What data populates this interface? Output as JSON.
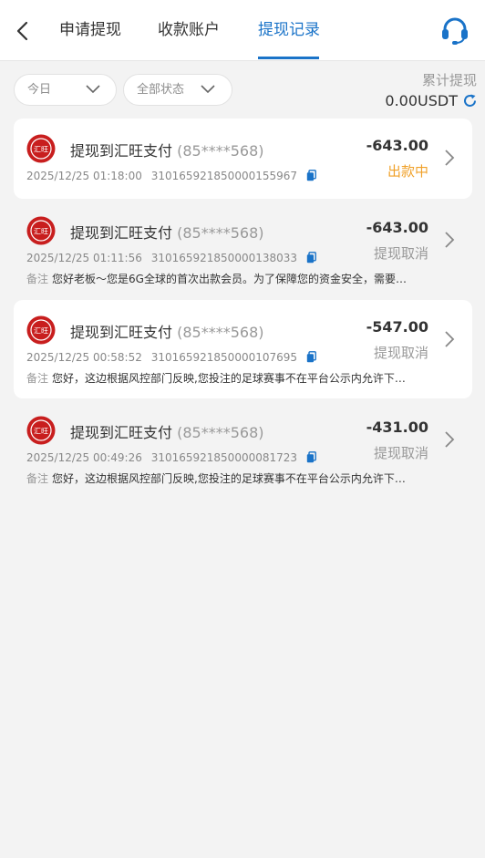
{
  "header": {
    "tabs": [
      {
        "label": "申请提现",
        "active": false
      },
      {
        "label": "收款账户",
        "active": false
      },
      {
        "label": "提现记录",
        "active": true
      }
    ],
    "accent_color": "#1a73c8"
  },
  "filters": {
    "date": "今日",
    "status": "全部状态"
  },
  "summary": {
    "label": "累计提现",
    "value": "0.00USDT"
  },
  "records": [
    {
      "logo_text": "汇旺",
      "title": "提现到汇旺支付",
      "account": "(85****568)",
      "amount": "-643.00",
      "status": "出款中",
      "datetime": "2025/12/25 01:18:00",
      "order_no": "310165921850000155967",
      "remark_label": "",
      "remark": ""
    },
    {
      "logo_text": "汇旺",
      "title": "提现到汇旺支付",
      "account": "(85****568)",
      "amount": "-643.00",
      "status": "提现取消",
      "datetime": "2025/12/25 01:11:56",
      "order_no": "310165921850000138033",
      "remark_label": "备注",
      "remark": "您好老板～您是6G全球的首次出款会员。为了保障您的资金安全，需要…"
    },
    {
      "logo_text": "汇旺",
      "title": "提现到汇旺支付",
      "account": "(85****568)",
      "amount": "-547.00",
      "status": "提现取消",
      "datetime": "2025/12/25 00:58:52",
      "order_no": "310165921850000107695",
      "remark_label": "备注",
      "remark": "您好，这边根据风控部门反映,您投注的足球赛事不在平台公示内允许下…"
    },
    {
      "logo_text": "汇旺",
      "title": "提现到汇旺支付",
      "account": "(85****568)",
      "amount": "-431.00",
      "status": "提现取消",
      "datetime": "2025/12/25 00:49:26",
      "order_no": "310165921850000081723",
      "remark_label": "备注",
      "remark": "您好，这边根据风控部门反映,您投注的足球赛事不在平台公示内允许下…"
    }
  ]
}
